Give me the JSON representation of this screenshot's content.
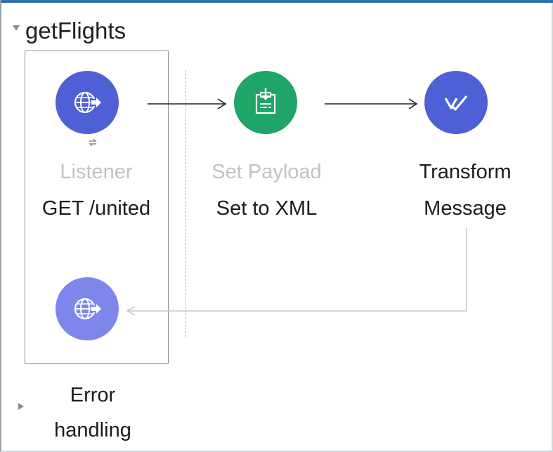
{
  "flow": {
    "name": "getFlights"
  },
  "nodes": {
    "listener": {
      "title": "Listener",
      "subtitle": "GET /united",
      "icon": "globe-arrow-icon",
      "color": "#4f5fd6"
    },
    "set_payload": {
      "title": "Set Payload",
      "subtitle": "Set to XML",
      "icon": "clipboard-download-icon",
      "color": "#1ea567"
    },
    "transform": {
      "title_line1": "Transform",
      "title_line2": "Message",
      "icon": "dataweave-icon",
      "color": "#4f5fd6"
    },
    "response": {
      "icon": "globe-arrow-icon",
      "color": "#7e86ec"
    }
  },
  "error_handling": {
    "line1": "Error",
    "line2": "handling"
  },
  "colors": {
    "accent_bar": "#2f6fab",
    "faded_text": "#c2c2c2"
  }
}
